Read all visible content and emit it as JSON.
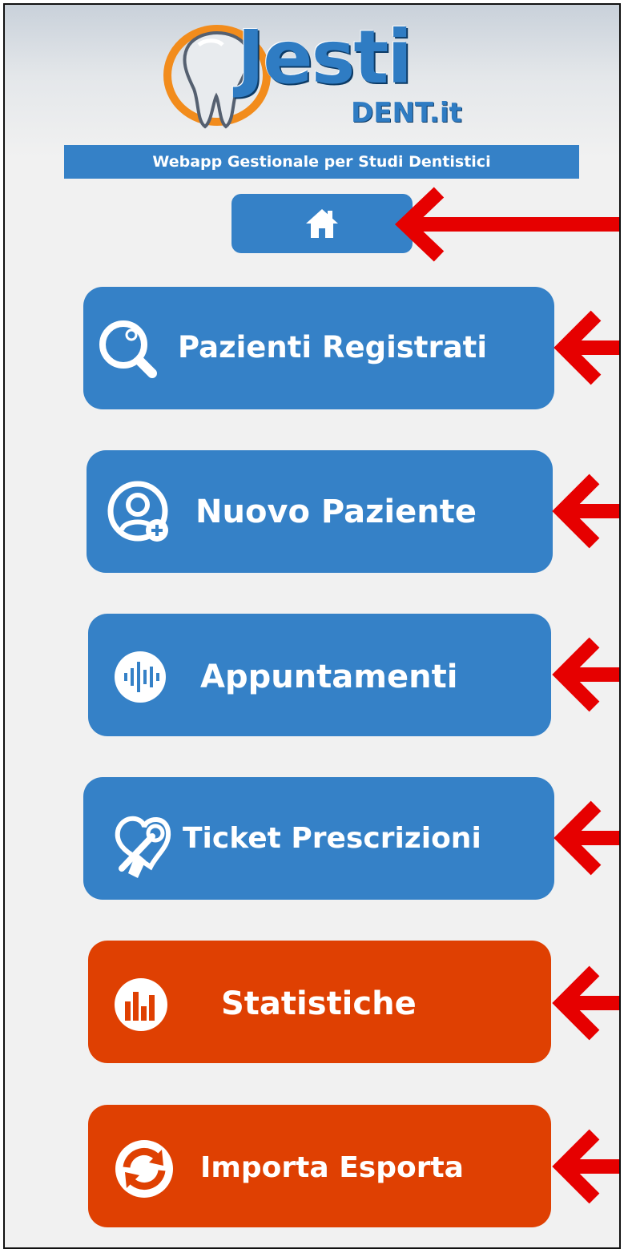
{
  "header": {
    "logo_word": "Jesti",
    "logo_sub": "DENT.it",
    "tagline": "Webapp Gestionale per Studi Dentistici"
  },
  "home": {
    "icon": "home-icon"
  },
  "menu": {
    "items": [
      {
        "label": "Pazienti Registrati",
        "icon": "search-icon",
        "color": "#3581c7"
      },
      {
        "label": "Nuovo Paziente",
        "icon": "user-add-icon",
        "color": "#3581c7"
      },
      {
        "label": "Appuntamenti",
        "icon": "audio-wave-icon",
        "color": "#3581c7"
      },
      {
        "label": "Ticket Prescrizioni",
        "icon": "tooth-tools-icon",
        "color": "#3581c7"
      },
      {
        "label": "Statistiche",
        "icon": "bar-chart-icon",
        "color": "#df4002"
      },
      {
        "label": "Importa Esporta",
        "icon": "sync-icon",
        "color": "#df4002"
      }
    ]
  },
  "annotation": {
    "arrow_color": "#e60000"
  }
}
